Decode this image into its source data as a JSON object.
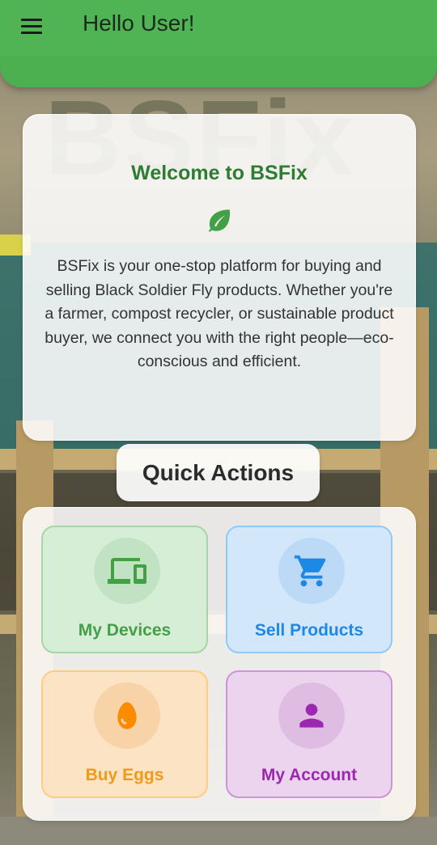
{
  "appbar": {
    "title": "Hello User!",
    "menu_icon": "menu-icon"
  },
  "background": {
    "watermark": "BSFix"
  },
  "welcome": {
    "title": "Welcome to BSFix",
    "icon": "leaf-icon",
    "body": "BSFix is your one-stop platform for buying and selling Black Soldier Fly products. Whether you're a farmer, compost recycler, or sustainable product buyer, we connect you with the right people—eco-conscious and efficient."
  },
  "quick_actions": {
    "title": "Quick Actions",
    "items": [
      {
        "label": "My Devices",
        "icon": "devices-icon",
        "color": "#43a047"
      },
      {
        "label": "Sell Products",
        "icon": "cart-icon",
        "color": "#1e88e5"
      },
      {
        "label": "Buy Eggs",
        "icon": "egg-icon",
        "color": "#fb8c00"
      },
      {
        "label": "My Account",
        "icon": "person-icon",
        "color": "#9c27b0"
      }
    ]
  },
  "colors": {
    "primary": "#4caf50",
    "title_green": "#2e7d32"
  }
}
